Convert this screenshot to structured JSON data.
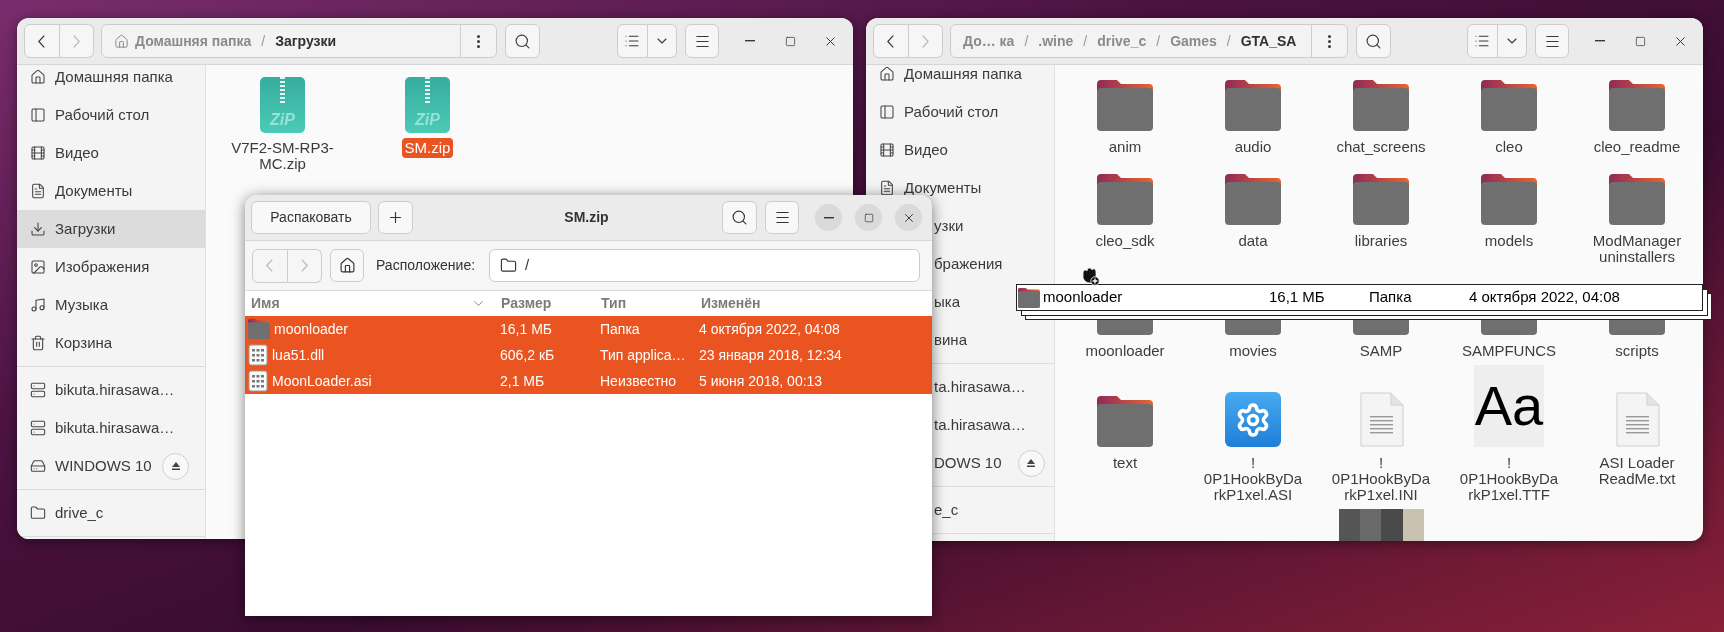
{
  "downloads_window": {
    "nav": {
      "back_disabled": false,
      "forward_disabled": true
    },
    "path_separator": "/",
    "path": [
      {
        "label": "Домашняя папка",
        "kind": "home",
        "current": false
      },
      {
        "label": "Загрузки",
        "current": true
      }
    ],
    "sidebar": [
      {
        "items": [
          {
            "label": "Домашняя папка",
            "kind": "home",
            "selected": false,
            "covered": false,
            "ejectable": false
          },
          {
            "label": "Рабочий стол",
            "kind": "desktop",
            "selected": false,
            "covered": false,
            "ejectable": false
          },
          {
            "label": "Видео",
            "kind": "videos",
            "selected": false,
            "covered": false,
            "ejectable": false
          },
          {
            "label": "Документы",
            "kind": "documents",
            "selected": false,
            "covered": false,
            "ejectable": false
          },
          {
            "label": "Загрузки",
            "kind": "downloads",
            "selected": true,
            "covered": false,
            "ejectable": false
          },
          {
            "label": "Изображения",
            "kind": "pictures",
            "selected": false,
            "covered": false,
            "ejectable": false
          },
          {
            "label": "Музыка",
            "kind": "music",
            "selected": false,
            "covered": false,
            "ejectable": false
          },
          {
            "label": "Корзина",
            "kind": "trash",
            "selected": false,
            "covered": false,
            "ejectable": false
          }
        ]
      },
      {
        "items": [
          {
            "label": "bikuta.hirasawa…",
            "kind": "network",
            "selected": false,
            "covered": false,
            "ejectable": false
          },
          {
            "label": "bikuta.hirasawa…",
            "kind": "network",
            "selected": false,
            "covered": false,
            "ejectable": false
          },
          {
            "label": "WINDOWS 10",
            "kind": "drive",
            "selected": false,
            "covered": false,
            "ejectable": true
          }
        ]
      },
      {
        "items": [
          {
            "label": "drive_c",
            "kind": "folder",
            "selected": false,
            "covered": false,
            "ejectable": false
          }
        ]
      }
    ],
    "files": [
      {
        "name": "V7F2-SM-RP3-\nMC.zip",
        "kind": "zip",
        "icon_text": "ZiP",
        "selected": false
      },
      {
        "name": "SM.zip",
        "kind": "zip",
        "icon_text": "ZiP",
        "selected": true
      }
    ]
  },
  "game_window": {
    "nav": {
      "back_disabled": false,
      "forward_disabled": true
    },
    "path_separator": "/",
    "path": [
      {
        "label": "До… ка",
        "current": false
      },
      {
        "label": ".wine",
        "current": false
      },
      {
        "label": "drive_c",
        "current": false
      },
      {
        "label": "Games",
        "current": false
      },
      {
        "label": "GTA_SA",
        "current": true
      }
    ],
    "sidebar": [
      {
        "items": [
          {
            "label": "Домашняя папка",
            "kind": "home",
            "selected": false,
            "covered": false,
            "ejectable": false
          },
          {
            "label": "Рабочий стол",
            "kind": "desktop",
            "selected": false,
            "covered": false,
            "ejectable": false
          },
          {
            "label": "Видео",
            "kind": "videos",
            "selected": false,
            "covered": false,
            "ejectable": false
          },
          {
            "label": "Документы",
            "kind": "documents",
            "selected": false,
            "covered": false,
            "ejectable": false
          },
          {
            "label": "узки",
            "kind": "downloads",
            "selected": false,
            "covered": true,
            "ejectable": false
          },
          {
            "label": "бражения",
            "kind": "pictures",
            "selected": false,
            "covered": true,
            "ejectable": false
          },
          {
            "label": "ыка",
            "kind": "music",
            "selected": false,
            "covered": true,
            "ejectable": false
          },
          {
            "label": "вина",
            "kind": "trash",
            "selected": false,
            "covered": true,
            "ejectable": false
          }
        ]
      },
      {
        "items": [
          {
            "label": "ta.hirasawa…",
            "kind": "network",
            "selected": false,
            "covered": true,
            "ejectable": false
          },
          {
            "label": "ta.hirasawa…",
            "kind": "network",
            "selected": false,
            "covered": true,
            "ejectable": false
          },
          {
            "label": "DOWS 10",
            "kind": "drive",
            "selected": false,
            "covered": true,
            "ejectable": true
          }
        ]
      },
      {
        "items": [
          {
            "label": "e_c",
            "kind": "folder",
            "selected": false,
            "covered": true,
            "ejectable": false
          }
        ]
      }
    ],
    "items": [
      {
        "name": "anim",
        "kind": "folder"
      },
      {
        "name": "audio",
        "kind": "folder"
      },
      {
        "name": "chat_screens",
        "kind": "folder"
      },
      {
        "name": "cleo",
        "kind": "folder"
      },
      {
        "name": "cleo_readme",
        "kind": "folder"
      },
      {
        "name": "cleo_sdk",
        "kind": "folder"
      },
      {
        "name": "data",
        "kind": "folder"
      },
      {
        "name": "libraries",
        "kind": "folder"
      },
      {
        "name": "models",
        "kind": "folder"
      },
      {
        "name": "ModManager\nuninstallers",
        "kind": "folder"
      },
      {
        "name": "moonloader",
        "kind": "folder"
      },
      {
        "name": "movies",
        "kind": "folder"
      },
      {
        "name": "SAMP",
        "kind": "folder"
      },
      {
        "name": "SAMPFUNCS",
        "kind": "folder"
      },
      {
        "name": "scripts",
        "kind": "folder"
      },
      {
        "name": "text",
        "kind": "folder"
      },
      {
        "name": "!\n0P1HookByDa\nrkP1xel.ASI",
        "kind": "settings_file"
      },
      {
        "name": "!\n0P1HookByDa\nrkP1xel.INI",
        "kind": "text_file"
      },
      {
        "name": "!\n0P1HookByDa\nrkP1xel.TTF",
        "kind": "font_file",
        "icon_text": "Aa"
      },
      {
        "name": "ASI Loader\nReadMe.txt",
        "kind": "text_file"
      },
      {
        "kind": "image"
      }
    ]
  },
  "archive_window": {
    "title": "SM.zip",
    "extract_button": "Распаковать",
    "nav": {
      "back_disabled": true,
      "forward_disabled": true
    },
    "location_label": "Расположение:",
    "location": "/",
    "columns": [
      "Имя",
      "Размер",
      "Тип",
      "Изменён"
    ],
    "rows": [
      {
        "name": "moonloader",
        "kind": "folder",
        "size": "16,1 МБ",
        "type": "Папка",
        "modified": "4 октября 2022, 04:08",
        "selected": true
      },
      {
        "name": "lua51.dll",
        "kind": "binary",
        "size": "606,2 кБ",
        "type": "Тип applica…",
        "modified": "23 января 2018, 12:34",
        "selected": true
      },
      {
        "name": "MoonLoader.asi",
        "kind": "binary",
        "size": "2,1 МБ",
        "type": "Неизвестно",
        "modified": "5 июня 2018, 00:13",
        "selected": true
      }
    ]
  },
  "drag_preview": {
    "name": "moonloader",
    "size": "16,1 МБ",
    "type": "Папка",
    "modified": "4 октября 2022, 04:08"
  }
}
